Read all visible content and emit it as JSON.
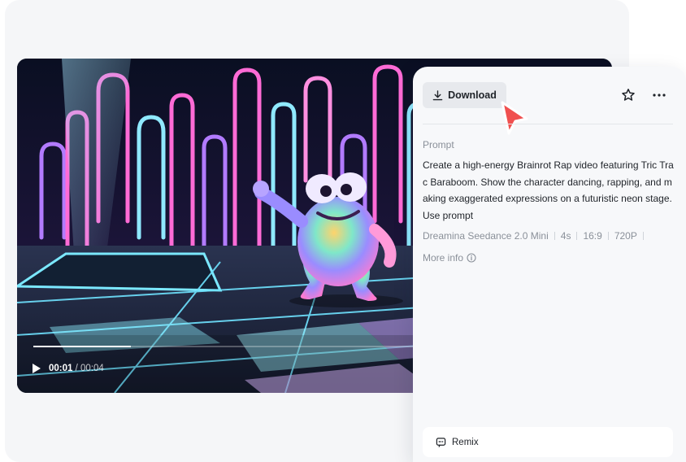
{
  "video": {
    "current_time": "00:01",
    "separator": "/",
    "total_time": "00:04",
    "progress": 0.25
  },
  "panel": {
    "download_label": "Download",
    "prompt_label": "Prompt",
    "prompt_text": "Create a high-energy Brainrot Rap video featuring Tric Trac Baraboom. Show the character dancing, rapping, and making exaggerated expressions on a futuristic neon stage.Use prompt",
    "meta": {
      "model": "Dreamina Seedance 2.0 Mini",
      "duration": "4s",
      "aspect_ratio": "16:9",
      "resolution": "720P"
    },
    "more_info_label": "More info",
    "remix_label": "Remix"
  },
  "icons": {
    "download": "download-icon",
    "star": "star-outline-icon",
    "more": "more-horizontal-icon",
    "info": "info-circle-icon",
    "remix": "remix-icon",
    "play": "play-icon",
    "cursor": "cursor-pointer-icon"
  },
  "colors": {
    "page_bg": "#ffffff",
    "card_bg": "#f5f6f8",
    "panel_bg": "#f7f8fa",
    "button_bg": "#e7e9ed",
    "cursor_red": "#f0504f",
    "muted_text": "#8a9099"
  }
}
